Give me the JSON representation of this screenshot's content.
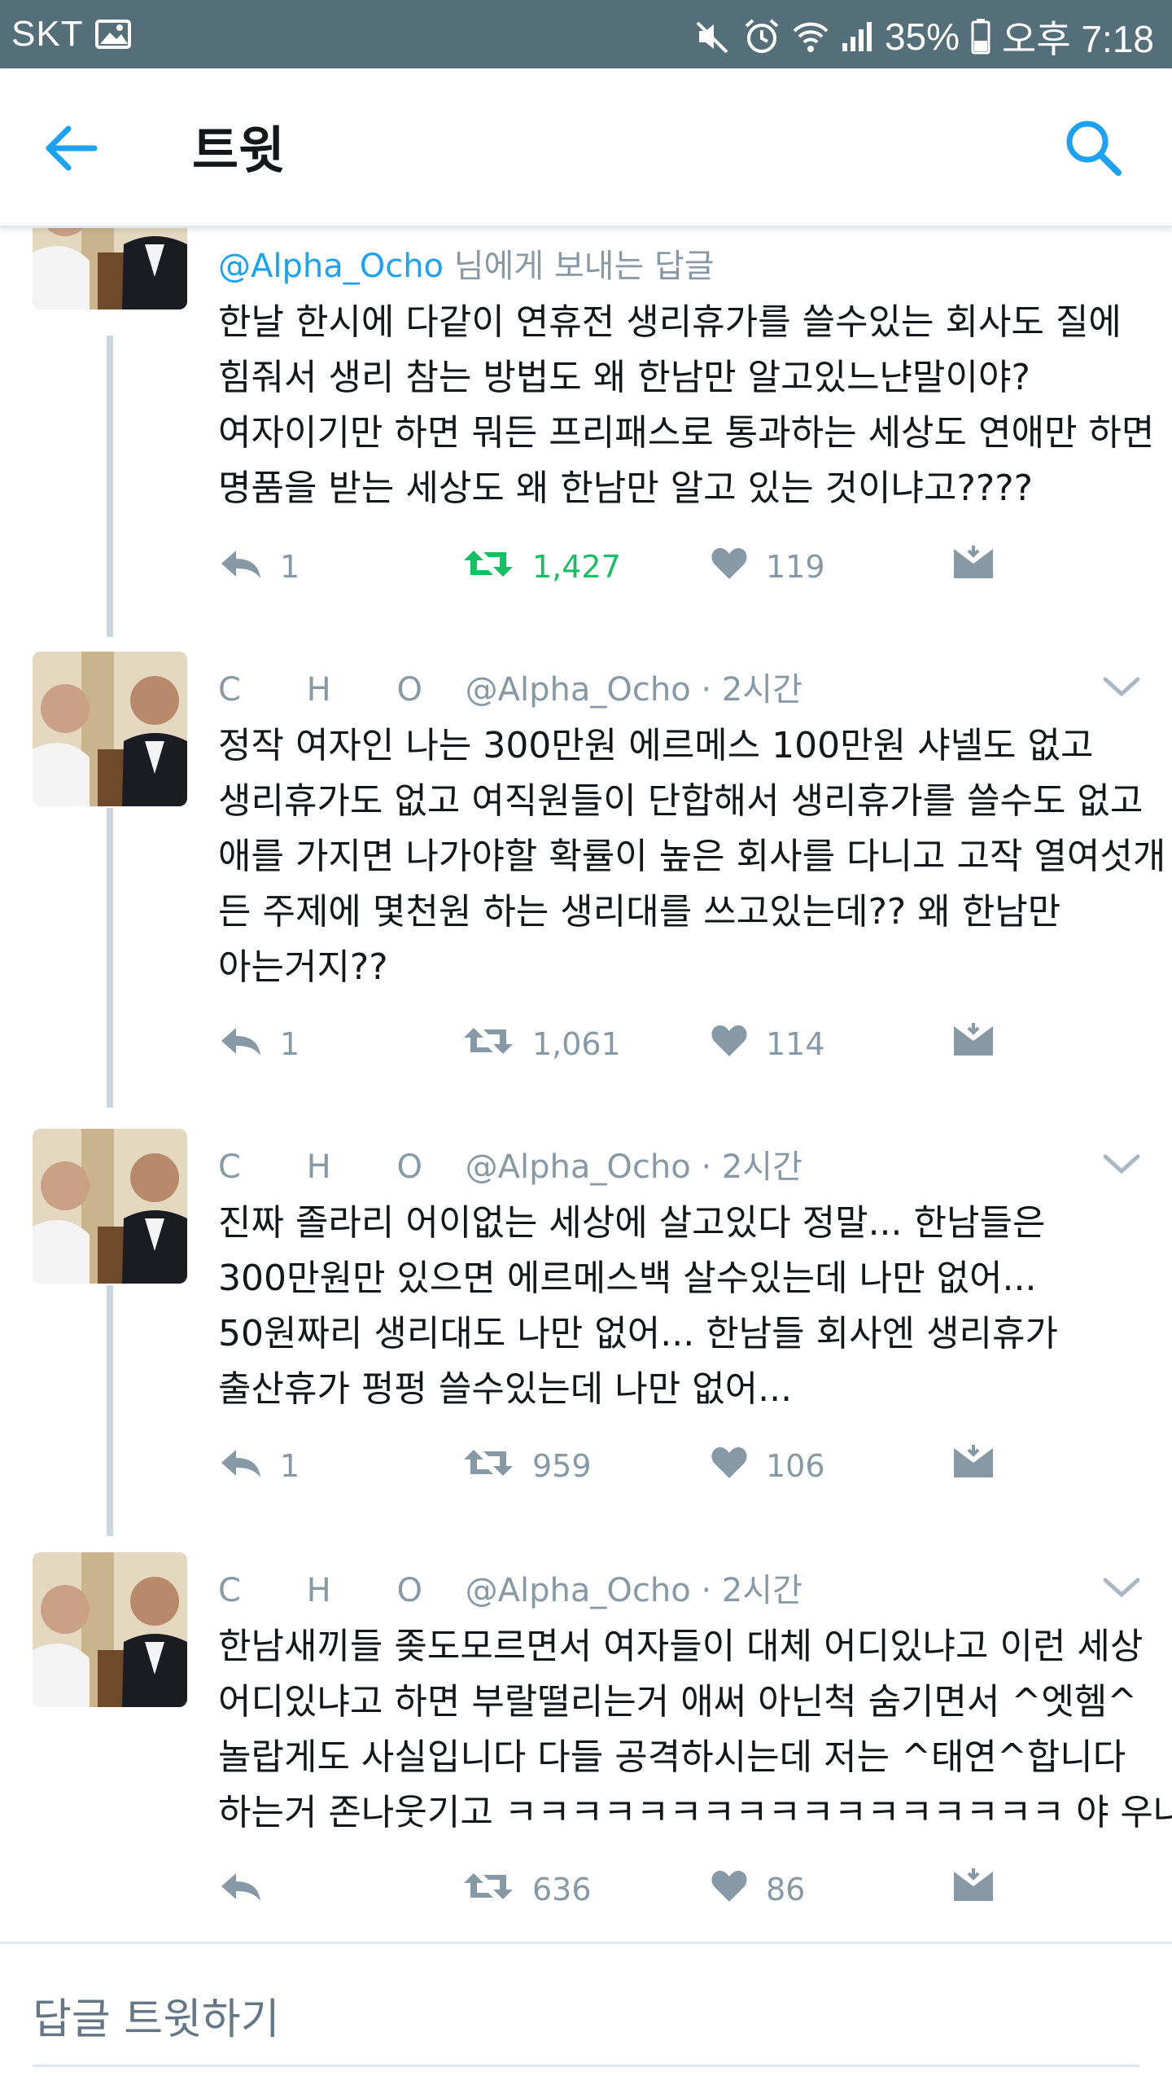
{
  "status_bar": {
    "carrier": "SKT",
    "battery": "35%",
    "time": "오후 7:18",
    "icons": [
      "gallery-icon",
      "mute-icon",
      "alarm-icon",
      "wifi-icon",
      "signal-icon",
      "battery-icon"
    ]
  },
  "app_bar": {
    "title": "트윗",
    "back_icon": "arrow-left-icon",
    "search_icon": "search-icon",
    "accent": "#1da1f2"
  },
  "colors": {
    "status_bar_bg": "#546e7a",
    "retweeted": "#17bf63",
    "muted": "#8899a6",
    "link": "#1da1f2"
  },
  "tweets": [
    {
      "reply_to_prefix": "",
      "reply_to_handle": "@Alpha_Ocho",
      "reply_to_suffix": "님에게 보내는 답글",
      "lines": [
        "한날 한시에 다같이 연휴전 생리휴가를 쓸수있는 회사도 질에",
        "힘줘서 생리 참는 방법도 왜 한남만 알고있느냔말이야?",
        "여자이기만 하면 뭐든 프리패스로 통과하는 세상도 연애만 하면",
        "명품을 받는 세상도 왜 한남만 알고 있는 것이냐고????"
      ],
      "replies": "1",
      "retweets": "1,427",
      "retweeted": true,
      "likes": "119"
    },
    {
      "display_name": "C H O",
      "handle": "@Alpha_Ocho",
      "time": "· 2시간",
      "lines": [
        "정작 여자인 나는 300만원 에르메스 100만원 샤넬도 없고",
        "생리휴가도 없고 여직원들이 단합해서 생리휴가를 쓸수도 없고",
        "애를 가지면 나가야할 확률이 높은 회사를 다니고 고작 열여섯개",
        "든 주제에 몇천원 하는 생리대를 쓰고있는데?? 왜 한남만",
        "아는거지??"
      ],
      "replies": "1",
      "retweets": "1,061",
      "retweeted": false,
      "likes": "114"
    },
    {
      "display_name": "C H O",
      "handle": "@Alpha_Ocho",
      "time": "· 2시간",
      "lines": [
        "진짜 졸라리 어이없는 세상에 살고있다 정말... 한남들은",
        "300만원만 있으면 에르메스백 살수있는데 나만 없어...",
        "50원짜리 생리대도 나만 없어... 한남들 회사엔 생리휴가",
        "출산휴가 펑펑 쓸수있는데 나만 없어..."
      ],
      "replies": "1",
      "retweets": "959",
      "retweeted": false,
      "likes": "106"
    },
    {
      "display_name": "C H O",
      "handle": "@Alpha_Ocho",
      "time": "· 2시간",
      "lines": [
        "한남새끼들 좆도모르면서 여자들이 대체 어디있냐고 이런 세상",
        "어디있냐고 하면 부랄떨리는거 애써 아닌척 숨기면서 ^엣헴^",
        "놀랍게도 사실입니다 다들 공격하시는데 저는 ^태연^합니다",
        "하는거 존나웃기고 ㅋㅋㅋㅋㅋㅋㅋㅋㅋㅋㅋㅋㅋㅋㅋㅋㅋ 야 우냐?"
      ],
      "replies": "",
      "retweets": "636",
      "retweeted": false,
      "likes": "86"
    }
  ],
  "reply_bar": {
    "placeholder": "답글 트윗하기"
  }
}
